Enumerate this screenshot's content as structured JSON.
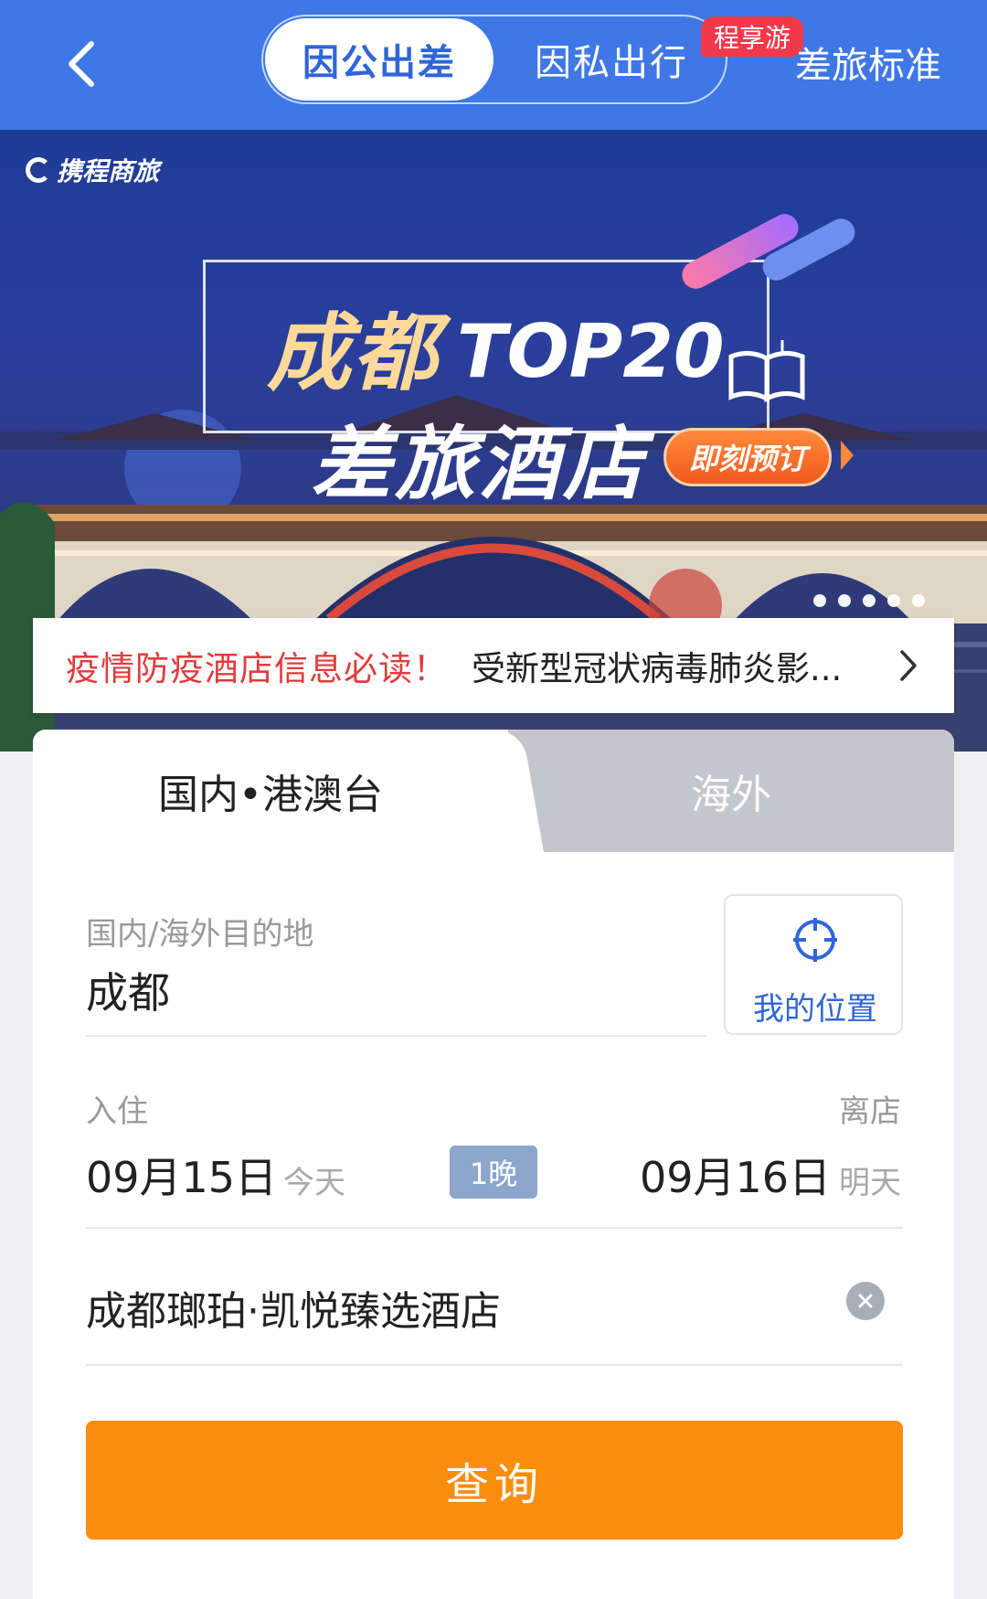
{
  "header": {
    "tabs": [
      {
        "label": "因公出差",
        "active": true
      },
      {
        "label": "因私出行",
        "active": false
      }
    ],
    "promo_badge": "程享游",
    "travel_standard": "差旅标准",
    "colors": {
      "header_bg": "#3f78e6",
      "badge": "#f2384b"
    }
  },
  "banner": {
    "logo_text": "携程商旅",
    "city": "成都",
    "headline": "TOP20",
    "subtitle": "差旅酒店",
    "cta": "即刻预订",
    "slide_count": 5
  },
  "notice": {
    "highlight": "疫情防疫酒店信息必读！",
    "text": "受新型冠状病毒肺炎影..."
  },
  "search": {
    "tabs": [
      {
        "label": "国内•港澳台",
        "active": true
      },
      {
        "label": "海外",
        "active": false
      }
    ],
    "destination_label": "国内/海外目的地",
    "destination_value": "成都",
    "my_location": "我的位置",
    "checkin_label": "入住",
    "checkin_date": "09月15日",
    "checkin_day": "今天",
    "nights": "1晚",
    "checkout_label": "离店",
    "checkout_date": "09月16日",
    "checkout_day": "明天",
    "keyword": "成都瑯珀·凯悦臻选酒店",
    "submit": "查询",
    "colors": {
      "submit": "#fa8c0e",
      "accent": "#2f65d8"
    }
  }
}
